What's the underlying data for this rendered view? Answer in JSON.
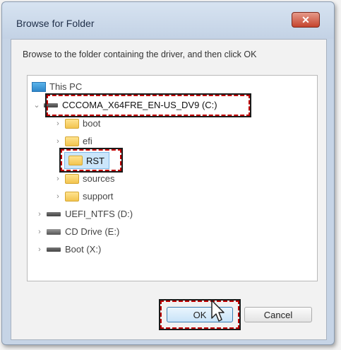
{
  "window": {
    "title": "Browse for Folder",
    "close_glyph": "✕"
  },
  "instructions": "Browse to the folder containing the driver, and then click OK",
  "tree": {
    "this_pc": "This PC",
    "drive_c": "CCCOMA_X64FRE_EN-US_DV9 (C:)",
    "folders": {
      "boot": "boot",
      "efi": "efi",
      "rst": "RST",
      "sources": "sources",
      "support": "support"
    },
    "drive_d": "UEFI_NTFS (D:)",
    "drive_e": "CD Drive (E:)",
    "drive_x": "Boot (X:)"
  },
  "buttons": {
    "ok": "OK",
    "cancel": "Cancel"
  },
  "colors": {
    "highlight": "#c00000",
    "selection": "#cbe6fb"
  }
}
